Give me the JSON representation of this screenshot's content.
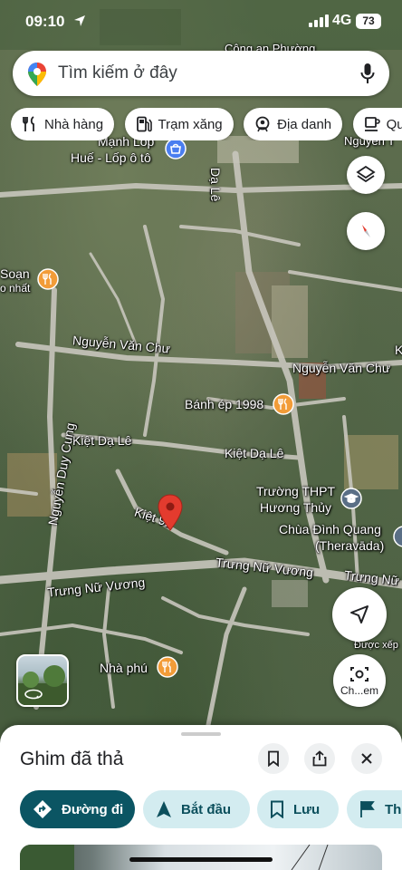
{
  "status_bar": {
    "time": "09:10",
    "network": "4G",
    "battery": "73"
  },
  "search": {
    "placeholder": "Tìm kiếm ở đây"
  },
  "chips": [
    {
      "label": "Nhà hàng",
      "icon": "fork-knife-icon"
    },
    {
      "label": "Trạm xăng",
      "icon": "gas-station-icon"
    },
    {
      "label": "Địa danh",
      "icon": "landmark-icon"
    },
    {
      "label": "Quá",
      "icon": "cafe-icon"
    }
  ],
  "map_labels": {
    "top_place_1": "Công an Phường",
    "top_place_2": "Nguyễn T",
    "tire_shop_1": "Mạnh Lốp",
    "tire_shop_2": "Huế - Lốp ô tô",
    "road_da_le": "Dạ Lê",
    "soan_1": "Soạn",
    "soan_2": "o nhất",
    "nvc_1": "Nguyễn Văn Chư",
    "nvc_2": "Nguyễn Văn Chư",
    "banh_ep": "Bánh ép 1998",
    "kiet_da_le_1": "Kiệt Dạ Lê",
    "kiet_da_le_2": "Kiệt Dạ Lê",
    "nguyen_duy_cung": "Nguyễn Duy Cung",
    "school_1": "Trường THPT",
    "school_2": "Hương Thủy",
    "pagoda_1": "Chùa Đình Quang",
    "pagoda_2": "(Theravāda)",
    "kiet_92": "Kiệt 92",
    "tnv_1": "Trưng Nữ Vương",
    "tnv_2": "Trưng Nữ Vương",
    "tnv_3": "Trưng Nữ Vương",
    "nha_phu": "Nhà phú",
    "duoc_xep": "Được xếp",
    "right_edge_k": "K"
  },
  "buttons": {
    "camera_label": "Ch...em"
  },
  "sheet": {
    "title": "Ghim đã thả",
    "actions": [
      {
        "label": "Đường đi",
        "icon": "directions-icon",
        "style": "primary"
      },
      {
        "label": "Bắt đầu",
        "icon": "navigation-arrow-icon",
        "style": "secondary"
      },
      {
        "label": "Lưu",
        "icon": "bookmark-icon",
        "style": "secondary"
      },
      {
        "label": "Th",
        "icon": "flag-icon",
        "style": "secondary"
      }
    ]
  },
  "colors": {
    "primary": "#0b5563",
    "secondary_bg": "#d3ecf0",
    "pin_red": "#e33b2e",
    "poi_orange": "#f29c38",
    "poi_blue": "#4a7ef0"
  }
}
